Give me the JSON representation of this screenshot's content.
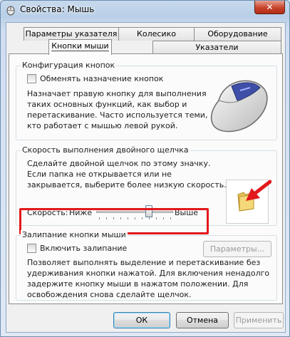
{
  "window": {
    "title": "Свойства: Мышь",
    "close_label": "✕"
  },
  "tabs_row_top": [
    {
      "label": "Параметры указателя"
    },
    {
      "label": "Колесико"
    },
    {
      "label": "Оборудование"
    }
  ],
  "tabs_row_bottom": [
    {
      "label": "Кнопки мыши",
      "active": true
    },
    {
      "label": "Указатели"
    }
  ],
  "button_config": {
    "title": "Конфигурация кнопок",
    "swap_label": "Обменять назначение кнопок",
    "swap_checked": false,
    "description": [
      "Назначает правую кнопку для выполнения",
      "таких основных функций, как выбор и",
      "перетаскивание. Часто используется теми,",
      "кто работает с мышью левой рукой."
    ]
  },
  "double_click": {
    "title": "Скорость выполнения двойного щелчка",
    "description": [
      "Сделайте двойной щелчок по этому значку.",
      "Если папка не открывается или не",
      "закрывается, выберите более низкую скорость."
    ],
    "speed_label": "Скорость:",
    "low_label": "Ниже",
    "high_label": "Выше",
    "speed_value": 0.7
  },
  "click_lock": {
    "title": "Залипание кнопки мыши",
    "enable_label": "Включить залипание",
    "enable_checked": false,
    "settings_button": "Параметры...",
    "description": [
      "Позволяет выполнять выделение и перетаскивание без",
      "удерживания кнопки нажатой. Для включения ненадолго",
      "задержите кнопку мыши в нажатом положении. Для",
      "освобождения снова сделайте щелчок."
    ]
  },
  "footer": {
    "ok": "ОК",
    "cancel": "Отмена",
    "apply": "Применить"
  },
  "colors": {
    "highlight": "#e2181b",
    "accent": "#3c7fb1"
  }
}
